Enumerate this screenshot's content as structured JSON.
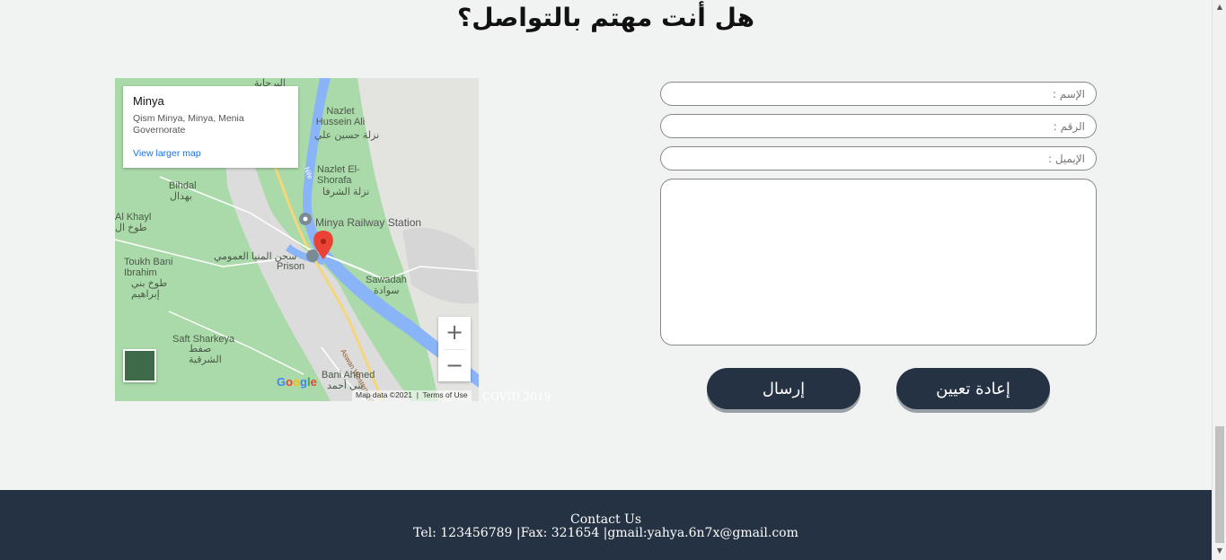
{
  "heading": "هل أنت مهتم بالتواصل؟",
  "map": {
    "place_title": "Minya",
    "place_address": "Qism Minya, Minya, Menia Governorate",
    "view_larger_link": "View larger map",
    "labels": {
      "nazlet_hussein_en": "Nazlet Hussein Ali",
      "nazlet_hussein_ar": "نزلة حسين علي",
      "nazlet_shorafa_en": "Nazlet El-Shorafa",
      "nazlet_shorafa_ar": "نزلة الشرفا",
      "bihdal_en": "Bihdal",
      "bihdal_ar": "بهدال",
      "khayl": "Al Khayl",
      "khayl_ar": "طوخ ال",
      "railway": "Minya Railway Station",
      "prison_ar": "سجن المنيا العمومي",
      "prison_en": "Prison",
      "toukh_en": "Toukh Bani Ibrahim",
      "toukh_ar": "طوخ بني إبراهيم",
      "sawadah_en": "Sawadah",
      "sawadah_ar": "سوادة",
      "saft_en": "Saft Sharkeya",
      "saft_ar": "صفط الشرقية",
      "bani_ahmed_en": "Bani Ahmed",
      "bani_ahmed_ar": "بني أحمد",
      "nile": "Nile",
      "road": "Aswan Western Agric",
      "top_ar": "البرجاية"
    },
    "zoom_in": "+",
    "zoom_out": "−",
    "google": "Google",
    "map_data": "Map data ©2021",
    "terms": "Terms of Use"
  },
  "covid_text": "COVID 2019",
  "form": {
    "name_placeholder": "الإسم :",
    "number_placeholder": "الرقم :",
    "email_placeholder": "الإيميل :",
    "send_label": "إرسال",
    "reset_label": "إعادة تعيين"
  },
  "footer": {
    "title": "Contact Us",
    "info": "Tel: 123456789 |Fax: 321654 |gmail:yahya.6n7x@gmail.com"
  },
  "colors": {
    "navy": "#253244",
    "page_bg": "#f1f2f2",
    "map_green": "#aadaa9",
    "pin_red": "#ea4335"
  }
}
